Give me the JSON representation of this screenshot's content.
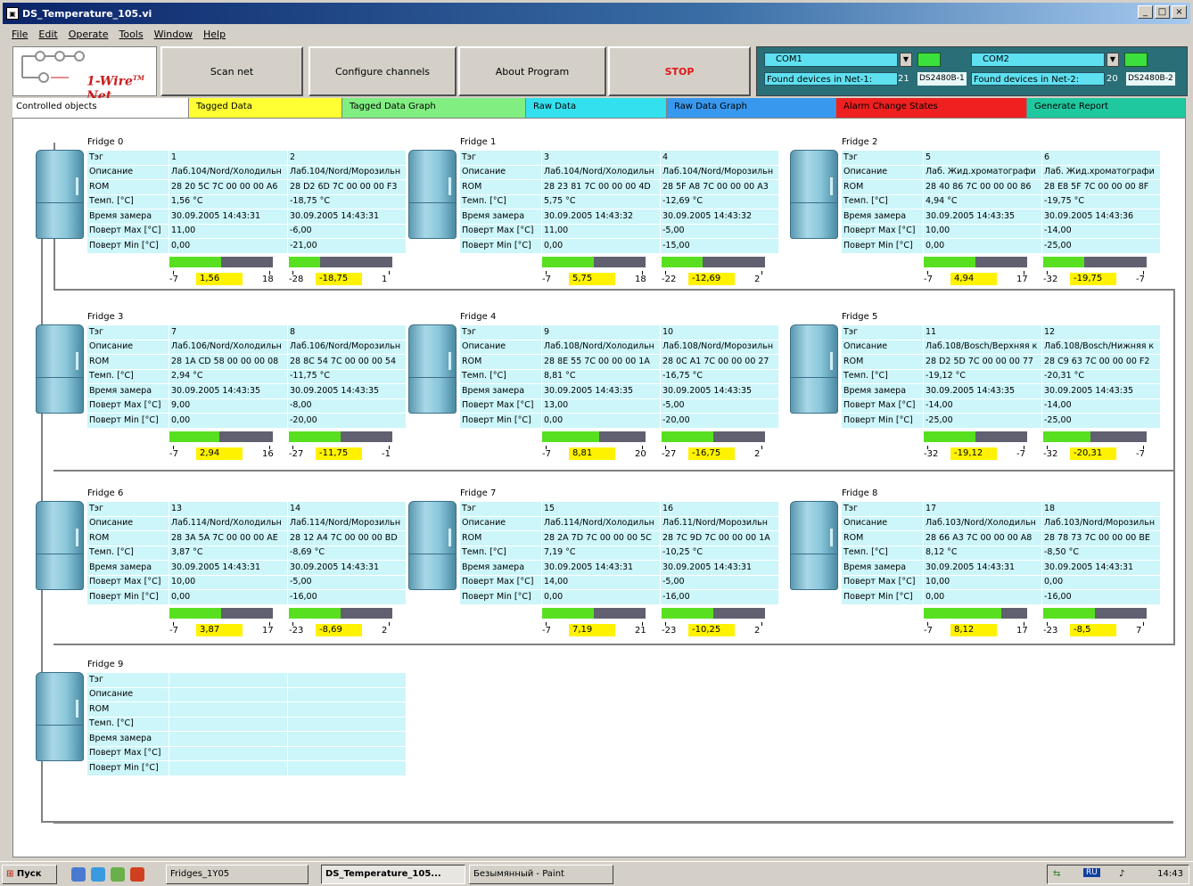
{
  "window": {
    "title": "DS_Temperature_105.vi",
    "menu": [
      "File",
      "Edit",
      "Operate",
      "Tools",
      "Window",
      "Help"
    ]
  },
  "toolbar": {
    "logo_text": "1-Wire",
    "logo_tm": "TM",
    "logo_net": "Net",
    "scan_net": "Scan net",
    "configure_channels": "Configure channels",
    "about_program": "About Program",
    "stop": "STOP"
  },
  "com": {
    "port1": "COM1",
    "port2": "COM2",
    "found1_label": "Found devices in Net-1:",
    "found1_count": "21",
    "found1_device": "DS2480B-1",
    "found2_label": "Found devices in Net-2:",
    "found2_count": "20",
    "found2_device": "DS2480B-2"
  },
  "tabs": [
    {
      "label": "Controlled objects",
      "color": "#ffffff"
    },
    {
      "label": "Tagged Data",
      "color": "#ffff33"
    },
    {
      "label": "Tagged Data Graph",
      "color": "#80ee80"
    },
    {
      "label": "Raw Data",
      "color": "#33e0ee"
    },
    {
      "label": "Raw Data Graph",
      "color": "#3898ee"
    },
    {
      "label": "Alarm Change States",
      "color": "#ee2020"
    },
    {
      "label": "Generate Report",
      "color": "#20c8a0"
    }
  ],
  "row_labels": [
    "Тэг",
    "Описание",
    "ROM",
    "Темп. [°C]",
    "Время замера",
    "Поверт Max [°C]",
    "Поверт Min [°C]"
  ],
  "fridges": [
    {
      "title": "Fridge 0",
      "c1": {
        "tag": "1",
        "desc": "Лаб.104/Nord/Холодильн",
        "rom": "28 20 5C 7C 00 00 00 A6",
        "temp": "1,56 °C",
        "time": "30.09.2005 14:43:31",
        "max": "11,00",
        "min": "0,00",
        "gauge": 0.5,
        "smin": "-7",
        "value": "1,56",
        "smax": "18"
      },
      "c2": {
        "tag": "2",
        "desc": "Лаб.104/Nord/Морозильн",
        "rom": "28 D2 6D 7C 00 00 00 F3",
        "temp": "-18,75 °C",
        "time": "30.09.2005 14:43:31",
        "max": "-6,00",
        "min": "-21,00",
        "gauge": 0.3,
        "smin": "-28",
        "value": "-18,75",
        "smax": "1"
      }
    },
    {
      "title": "Fridge 1",
      "c1": {
        "tag": "3",
        "desc": "Лаб.104/Nord/Холодильн",
        "rom": "28 23 81 7C 00 00 00 4D",
        "temp": "5,75 °C",
        "time": "30.09.2005 14:43:32",
        "max": "11,00",
        "min": "0,00",
        "gauge": 0.5,
        "smin": "-7",
        "value": "5,75",
        "smax": "18"
      },
      "c2": {
        "tag": "4",
        "desc": "Лаб.104/Nord/Морозильн",
        "rom": "28 5F A8 7C 00 00 00 A3",
        "temp": "-12,69 °C",
        "time": "30.09.2005 14:43:32",
        "max": "-5,00",
        "min": "-15,00",
        "gauge": 0.4,
        "smin": "-22",
        "value": "-12,69",
        "smax": "2"
      }
    },
    {
      "title": "Fridge 2",
      "c1": {
        "tag": "5",
        "desc": "Лаб. Жид.хроматографи",
        "rom": "28 40 86 7C 00 00 00 86",
        "temp": "4,94 °C",
        "time": "30.09.2005 14:43:35",
        "max": "10,00",
        "min": "0,00",
        "gauge": 0.5,
        "smin": "-7",
        "value": "4,94",
        "smax": "17"
      },
      "c2": {
        "tag": "6",
        "desc": "Лаб. Жид.хроматографи",
        "rom": "28 E8 5F 7C 00 00 00 8F",
        "temp": "-19,75 °C",
        "time": "30.09.2005 14:43:36",
        "max": "-14,00",
        "min": "-25,00",
        "gauge": 0.4,
        "smin": "-32",
        "value": "-19,75",
        "smax": "-7"
      }
    },
    {
      "title": "Fridge 3",
      "c1": {
        "tag": "7",
        "desc": "Лаб.106/Nord/Холодильн",
        "rom": "28 1A CD 58 00 00 00 08",
        "temp": "2,94 °C",
        "time": "30.09.2005 14:43:35",
        "max": "9,00",
        "min": "0,00",
        "gauge": 0.48,
        "smin": "-7",
        "value": "2,94",
        "smax": "16"
      },
      "c2": {
        "tag": "8",
        "desc": "Лаб.106/Nord/Морозильн",
        "rom": "28 8C 54 7C 00 00 00 54",
        "temp": "-11,75 °C",
        "time": "30.09.2005 14:43:35",
        "max": "-8,00",
        "min": "-20,00",
        "gauge": 0.5,
        "smin": "-27",
        "value": "-11,75",
        "smax": "-1"
      }
    },
    {
      "title": "Fridge 4",
      "c1": {
        "tag": "9",
        "desc": "Лаб.108/Nord/Холодильн",
        "rom": "28 8E 55 7C 00 00 00 1A",
        "temp": "8,81 °C",
        "time": "30.09.2005 14:43:35",
        "max": "13,00",
        "min": "0,00",
        "gauge": 0.55,
        "smin": "-7",
        "value": "8,81",
        "smax": "20"
      },
      "c2": {
        "tag": "10",
        "desc": "Лаб.108/Nord/Морозильн",
        "rom": "28 0C A1 7C 00 00 00 27",
        "temp": "-16,75 °C",
        "time": "30.09.2005 14:43:35",
        "max": "-5,00",
        "min": "-20,00",
        "gauge": 0.5,
        "smin": "-27",
        "value": "-16,75",
        "smax": "2"
      }
    },
    {
      "title": "Fridge 5",
      "c1": {
        "tag": "11",
        "desc": "Лаб.108/Bosch/Верхняя к",
        "rom": "28 D2 5D 7C 00 00 00 77",
        "temp": "-19,12 °C",
        "time": "30.09.2005 14:43:35",
        "max": "-14,00",
        "min": "-25,00",
        "gauge": 0.5,
        "smin": "-32",
        "value": "-19,12",
        "smax": "-7"
      },
      "c2": {
        "tag": "12",
        "desc": "Лаб.108/Bosch/Нижняя к",
        "rom": "28 C9 63 7C 00 00 00 F2",
        "temp": "-20,31 °C",
        "time": "30.09.2005 14:43:35",
        "max": "-14,00",
        "min": "-25,00",
        "gauge": 0.46,
        "smin": "-32",
        "value": "-20,31",
        "smax": "-7"
      }
    },
    {
      "title": "Fridge 6",
      "c1": {
        "tag": "13",
        "desc": "Лаб.114/Nord/Холодильн",
        "rom": "28 3A 5A 7C 00 00 00 AE",
        "temp": "3,87 °C",
        "time": "30.09.2005 14:43:31",
        "max": "10,00",
        "min": "0,00",
        "gauge": 0.5,
        "smin": "-7",
        "value": "3,87",
        "smax": "17"
      },
      "c2": {
        "tag": "14",
        "desc": "Лаб.114/Nord/Морозильн",
        "rom": "28 12 A4 7C 00 00 00 BD",
        "temp": "-8,69 °C",
        "time": "30.09.2005 14:43:31",
        "max": "-5,00",
        "min": "-16,00",
        "gauge": 0.5,
        "smin": "-23",
        "value": "-8,69",
        "smax": "2"
      }
    },
    {
      "title": "Fridge 7",
      "c1": {
        "tag": "15",
        "desc": "Лаб.114/Nord/Холодильн",
        "rom": "28 2A 7D 7C 00 00 00 5C",
        "temp": "7,19 °C",
        "time": "30.09.2005 14:43:31",
        "max": "14,00",
        "min": "0,00",
        "gauge": 0.5,
        "smin": "-7",
        "value": "7,19",
        "smax": "21"
      },
      "c2": {
        "tag": "16",
        "desc": "Лаб.11/Nord/Морозильн",
        "rom": "28 7C 9D 7C 00 00 00 1A",
        "temp": "-10,25 °C",
        "time": "30.09.2005 14:43:31",
        "max": "-5,00",
        "min": "-16,00",
        "gauge": 0.5,
        "smin": "-23",
        "value": "-10,25",
        "smax": "2"
      }
    },
    {
      "title": "Fridge 8",
      "c1": {
        "tag": "17",
        "desc": "Лаб.103/Nord/Холодильн",
        "rom": "28 66 A3 7C 00 00 00 A8",
        "temp": "8,12 °C",
        "time": "30.09.2005 14:43:31",
        "max": "10,00",
        "min": "0,00",
        "gauge": 0.75,
        "smin": "-7",
        "value": "8,12",
        "smax": "17"
      },
      "c2": {
        "tag": "18",
        "desc": "Лаб.103/Nord/Морозильн",
        "rom": "28 78 73 7C 00 00 00 BE",
        "temp": "-8,50 °C",
        "time": "30.09.2005 14:43:31",
        "max": "0,00",
        "min": "-16,00",
        "gauge": 0.5,
        "smin": "-23",
        "value": "-8,5",
        "smax": "7"
      }
    },
    {
      "title": "Fridge 9",
      "c1": {
        "tag": "",
        "desc": "",
        "rom": "",
        "temp": "",
        "time": "",
        "max": "",
        "min": ""
      },
      "c2": {
        "tag": "",
        "desc": "",
        "rom": "",
        "temp": "",
        "time": "",
        "max": "",
        "min": ""
      }
    }
  ],
  "taskbar": {
    "start": "Пуск",
    "fridges_folder": "Fridges_1Y05",
    "ds_task": "DS_Temperature_105...",
    "paint_task": "Безымянный - Paint",
    "clock": "14:43"
  }
}
